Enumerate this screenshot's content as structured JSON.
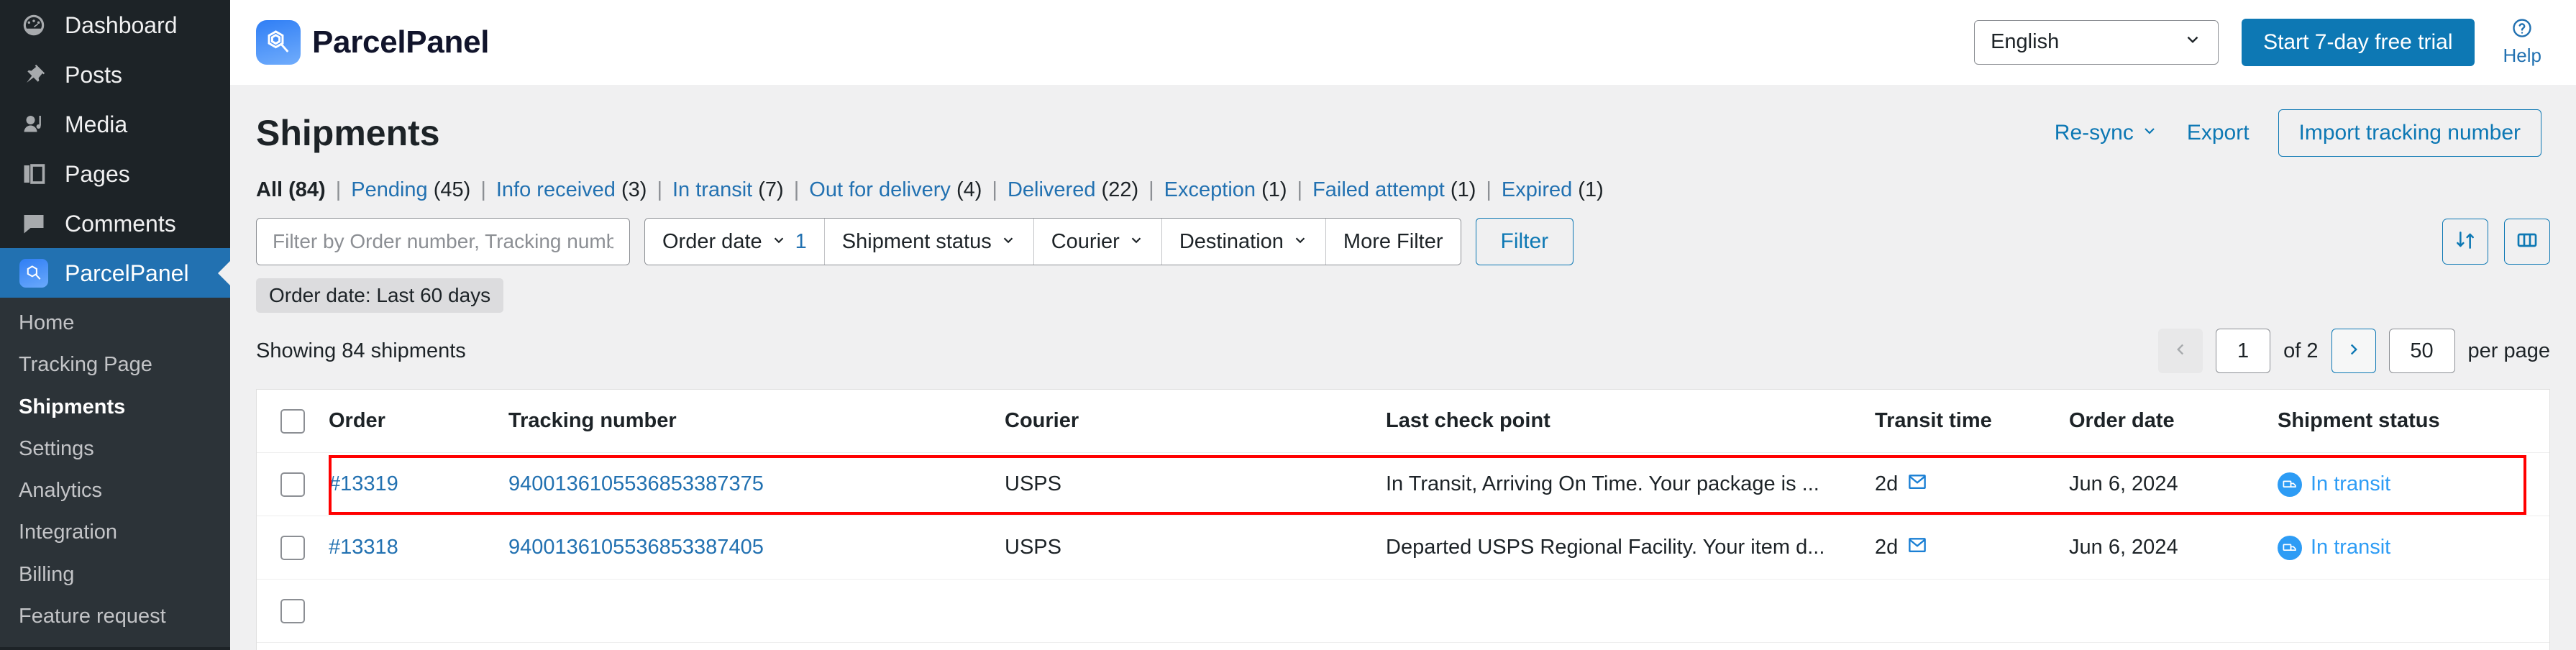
{
  "sidebar": {
    "wp_items": [
      {
        "label": "Dashboard",
        "icon": "dashboard-icon"
      },
      {
        "label": "Posts",
        "icon": "pin-icon"
      },
      {
        "label": "Media",
        "icon": "media-icon"
      },
      {
        "label": "Pages",
        "icon": "pages-icon"
      },
      {
        "label": "Comments",
        "icon": "comments-icon"
      },
      {
        "label": "ParcelPanel",
        "icon": "parcelpanel-icon"
      }
    ],
    "sub_items": [
      {
        "label": "Home"
      },
      {
        "label": "Tracking Page"
      },
      {
        "label": "Shipments"
      },
      {
        "label": "Settings"
      },
      {
        "label": "Analytics"
      },
      {
        "label": "Integration"
      },
      {
        "label": "Billing"
      },
      {
        "label": "Feature request"
      }
    ],
    "active_item": "ParcelPanel",
    "current_sub": "Shipments"
  },
  "topbar": {
    "brand_name": "ParcelPanel",
    "language": "English",
    "trial_button": "Start 7-day free trial",
    "help_label": "Help"
  },
  "page": {
    "title": "Shipments",
    "resync_label": "Re-sync",
    "export_label": "Export",
    "import_label": "Import tracking number"
  },
  "status_tabs": [
    {
      "label": "All",
      "count": "(84)",
      "current": true
    },
    {
      "label": "Pending",
      "count": "(45)",
      "current": false
    },
    {
      "label": "Info received",
      "count": "(3)",
      "current": false
    },
    {
      "label": "In transit",
      "count": "(7)",
      "current": false
    },
    {
      "label": "Out for delivery",
      "count": "(4)",
      "current": false
    },
    {
      "label": "Delivered",
      "count": "(22)",
      "current": false
    },
    {
      "label": "Exception",
      "count": "(1)",
      "current": false
    },
    {
      "label": "Failed attempt",
      "count": "(1)",
      "current": false
    },
    {
      "label": "Expired",
      "count": "(1)",
      "current": false
    }
  ],
  "filters": {
    "search_placeholder": "Filter by Order number, Tracking number,",
    "search_value": "",
    "order_date_label": "Order date",
    "order_date_badge": "1",
    "shipment_status_label": "Shipment status",
    "courier_label": "Courier",
    "destination_label": "Destination",
    "more_filter_label": "More Filter",
    "filter_button": "Filter",
    "applied_chip": "Order date: Last 60 days"
  },
  "pagination": {
    "showing": "Showing 84 shipments",
    "page_value": "1",
    "of_label": "of 2",
    "per_page_value": "50",
    "per_page_label": "per page"
  },
  "table": {
    "columns": [
      "Order",
      "Tracking number",
      "Courier",
      "Last check point",
      "Transit time",
      "Order date",
      "Shipment status"
    ],
    "rows": [
      {
        "order": "#13319",
        "tracking": "9400136105536853387375",
        "courier": "USPS",
        "last_check_point": "In Transit, Arriving On Time. Your package is ...",
        "transit_time": "2d",
        "order_date": "Jun 6, 2024",
        "status": "In transit",
        "flagged": true
      },
      {
        "order": "#13318",
        "tracking": "9400136105536853387405",
        "courier": "USPS",
        "last_check_point": "Departed USPS Regional Facility. Your item d...",
        "transit_time": "2d",
        "order_date": "Jun 6, 2024",
        "status": "In transit",
        "flagged": false
      }
    ]
  },
  "colors": {
    "wp_sidebar": "#1d2327",
    "wp_active": "#2271b1",
    "accent": "#0d78b4",
    "link": "#2271b1",
    "status_blue": "#2d9cf5",
    "highlight_red": "#ff0000"
  }
}
